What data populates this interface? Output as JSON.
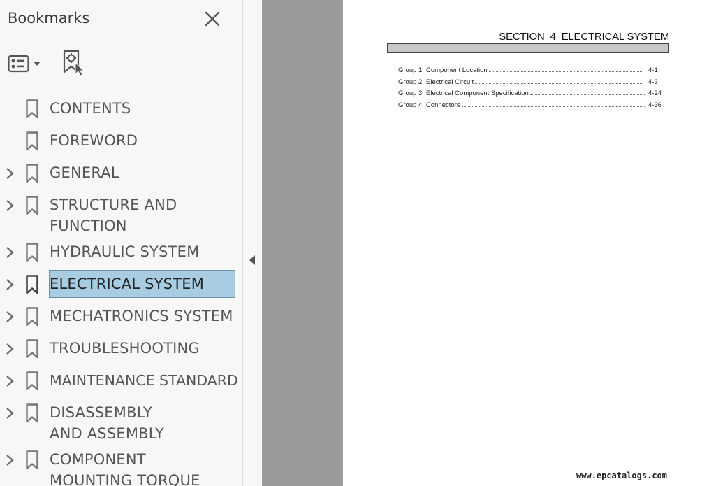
{
  "panel": {
    "title": "Bookmarks",
    "icons": {
      "close": "close-icon",
      "options": "bookmark-options-icon",
      "find": "find-current-bookmark-icon"
    }
  },
  "bookmarks": [
    {
      "label": "CONTENTS",
      "expandable": false,
      "selected": false
    },
    {
      "label": "FOREWORD",
      "expandable": false,
      "selected": false
    },
    {
      "label": "GENERAL",
      "expandable": true,
      "selected": false
    },
    {
      "label": "STRUCTURE AND FUNCTION",
      "expandable": true,
      "selected": false
    },
    {
      "label": "HYDRAULIC SYSTEM",
      "expandable": true,
      "selected": false
    },
    {
      "label": "ELECTRICAL SYSTEM",
      "expandable": true,
      "selected": true
    },
    {
      "label": "MECHATRONICS SYSTEM",
      "expandable": true,
      "selected": false
    },
    {
      "label": "TROUBLESHOOTING",
      "expandable": true,
      "selected": false
    },
    {
      "label": "MAINTENANCE STANDARD",
      "expandable": true,
      "selected": false
    },
    {
      "label": "DISASSEMBLY AND ASSEMBLY",
      "expandable": true,
      "selected": false
    },
    {
      "label": "COMPONENT MOUNTING TORQUE",
      "expandable": true,
      "selected": false
    }
  ],
  "document": {
    "section_title": "SECTION  4  ELECTRICAL SYSTEM",
    "toc": [
      {
        "group": "Group",
        "num": "1",
        "name": "Component Location",
        "page": "4-1"
      },
      {
        "group": "Group",
        "num": "2",
        "name": "Electrical Circuit",
        "page": "4-3"
      },
      {
        "group": "Group",
        "num": "3",
        "name": "Electrical Component Specification",
        "page": "4-24"
      },
      {
        "group": "Group",
        "num": "4",
        "name": "Connectors",
        "page": "4-36"
      }
    ],
    "watermark": "www.epcatalogs.com"
  },
  "colors": {
    "selection_fill": "#a8cce2",
    "selection_border": "#6a8fa8",
    "panel_bg": "#f7f7f7",
    "viewer_bg": "#9a9a9a"
  }
}
